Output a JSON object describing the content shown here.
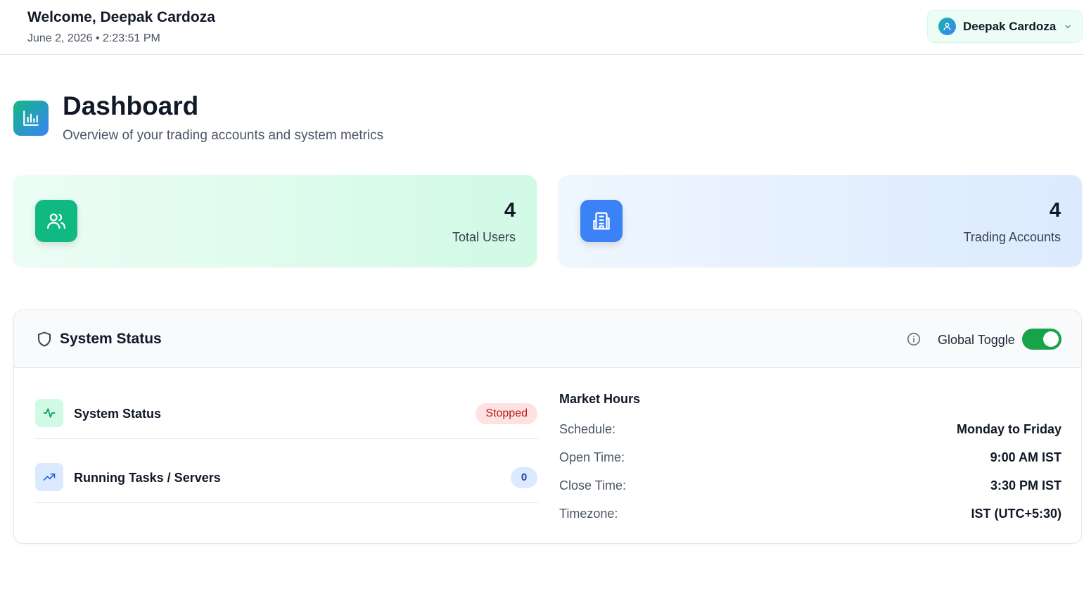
{
  "header": {
    "welcome": "Welcome, Deepak Cardoza",
    "datetime": "June 2, 2026 • 2:23:51 PM",
    "user_name": "Deepak Cardoza"
  },
  "page": {
    "title": "Dashboard",
    "subtitle": "Overview of your trading accounts and system metrics"
  },
  "stats": [
    {
      "value": "4",
      "label": "Total Users",
      "icon": "users-icon",
      "color": "#10b981"
    },
    {
      "value": "4",
      "label": "Trading Accounts",
      "icon": "building-icon",
      "color": "#3b82f6"
    }
  ],
  "system_panel": {
    "title": "System Status",
    "toggle_label": "Global Toggle",
    "toggle_on": true,
    "rows": [
      {
        "label": "System Status",
        "badge": "Stopped",
        "icon": "activity-icon"
      },
      {
        "label": "Running Tasks / Servers",
        "badge": "0",
        "icon": "trending-up-icon"
      }
    ],
    "market": {
      "title": "Market Hours",
      "items": [
        {
          "key": "Schedule:",
          "value": "Monday to Friday"
        },
        {
          "key": "Open Time:",
          "value": "9:00 AM IST"
        },
        {
          "key": "Close Time:",
          "value": "3:30 PM IST"
        },
        {
          "key": "Timezone:",
          "value": "IST (UTC+5:30)"
        }
      ]
    }
  },
  "colors": {
    "accent_green": "#10b981",
    "accent_blue": "#3b82f6",
    "toggle_on": "#16a34a",
    "stopped_bg": "#fee2e2",
    "stopped_text": "#b91c1c"
  }
}
